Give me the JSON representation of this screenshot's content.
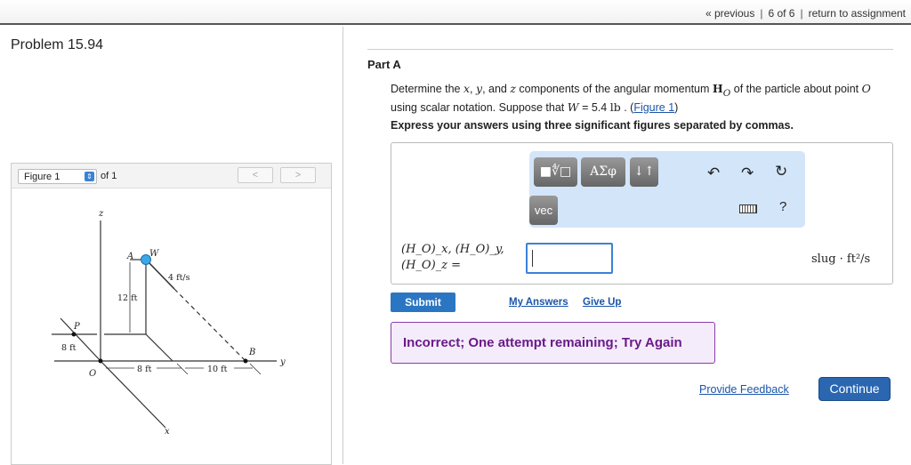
{
  "nav": {
    "previous": "« previous",
    "position": "6 of 6",
    "return": "return to assignment"
  },
  "problem": {
    "title": "Problem 15.94"
  },
  "figure": {
    "selector": "Figure 1",
    "of": "of 1",
    "prev": "<",
    "next": ">",
    "labels": {
      "z": "z",
      "y": "y",
      "x": "x",
      "A": "A",
      "W": "W",
      "P": "P",
      "O": "O",
      "B": "B",
      "speed": "4 ft/s",
      "h": "12 ft",
      "p_off": "8 ft",
      "d1": "8 ft",
      "d2": "10 ft"
    }
  },
  "part": {
    "title": "Part A",
    "q1": "Determine the ",
    "x": "x",
    ", ": ", ",
    "y": "y",
    ", and ": ", and ",
    "z": "z",
    "q2": " components of the angular momentum ",
    "H": "H",
    "O": "O",
    "q3": " of the particle about point ",
    "q4": " using scalar notation. Suppose that ",
    "W": "W",
    "q5": " = 5.4 ",
    "lb": "lb",
    ". (": " . (",
    "figlink": "Figure 1",
    ")": ")",
    "express": "Express your answers using three significant figures separated by commas."
  },
  "toolbar": {
    "templates": "■∜□",
    "greek": "ΑΣφ",
    "updown": "↓↑",
    "vec": "vec",
    "undo": "undo-icon",
    "redo": "redo-icon",
    "reset": "reset-icon",
    "keyboard": "keyboard-icon",
    "help": "?"
  },
  "answer": {
    "label1": "(H_O)_x, (H_O)_y,",
    "label2": "(H_O)_z =",
    "value": "",
    "unit": "slug · ft²/s"
  },
  "actions": {
    "submit": "Submit",
    "my_answers": "My Answers",
    "give_up": "Give Up"
  },
  "feedback": {
    "message": "Incorrect; One attempt remaining; Try Again"
  },
  "footer": {
    "provide_feedback": "Provide Feedback",
    "continue": "Continue"
  }
}
